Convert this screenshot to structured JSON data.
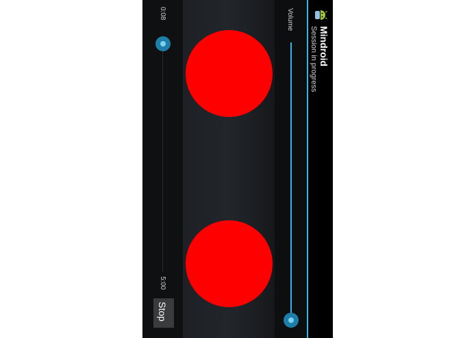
{
  "app": {
    "title": "Mindroid",
    "subtitle": "Session in progress",
    "icon": "android-app-icon"
  },
  "volume": {
    "label": "Volume",
    "level": 1.0
  },
  "session": {
    "elapsed": "0:08",
    "total": "5:00",
    "progress": 0.027,
    "stop_label": "Stop"
  },
  "colors": {
    "accent": "#33b5e5",
    "stimulus": "#ff0000"
  }
}
